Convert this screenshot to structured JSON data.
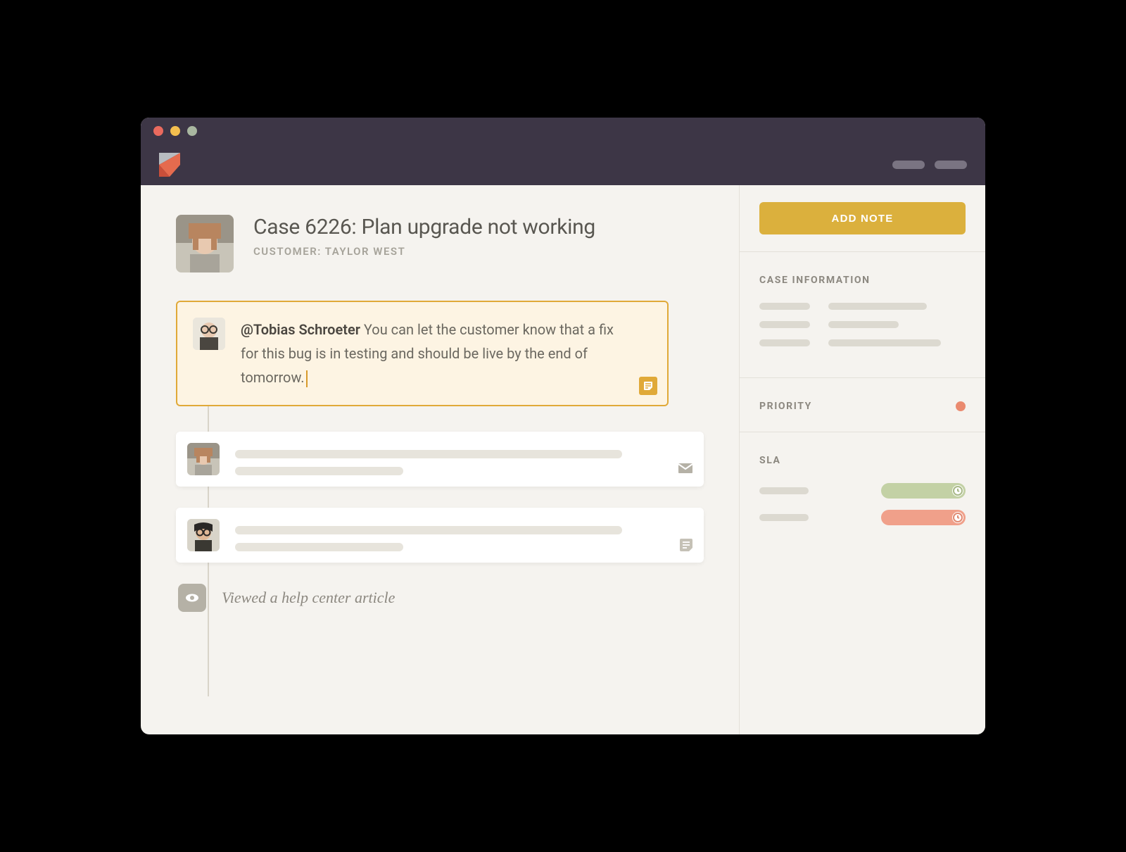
{
  "case": {
    "title": "Case 6226: Plan upgrade not working",
    "customer_label": "CUSTOMER: TAYLOR WEST"
  },
  "note": {
    "mention": "@Tobias Schroeter",
    "body": " You can let the customer know that a fix for this bug is in testing and should be live by the end of tomorrow."
  },
  "activity": {
    "viewed_article": "Viewed a help center article"
  },
  "sidebar": {
    "add_note_label": "ADD NOTE",
    "case_info_heading": "CASE INFORMATION",
    "priority_heading": "PRIORITY",
    "sla_heading": "SLA"
  },
  "colors": {
    "accent_yellow": "#dbb03d",
    "note_border": "#e0a938",
    "priority_dot": "#ea8a6f",
    "sla_green": "#c3d1a5",
    "sla_orange": "#f0a08a"
  }
}
